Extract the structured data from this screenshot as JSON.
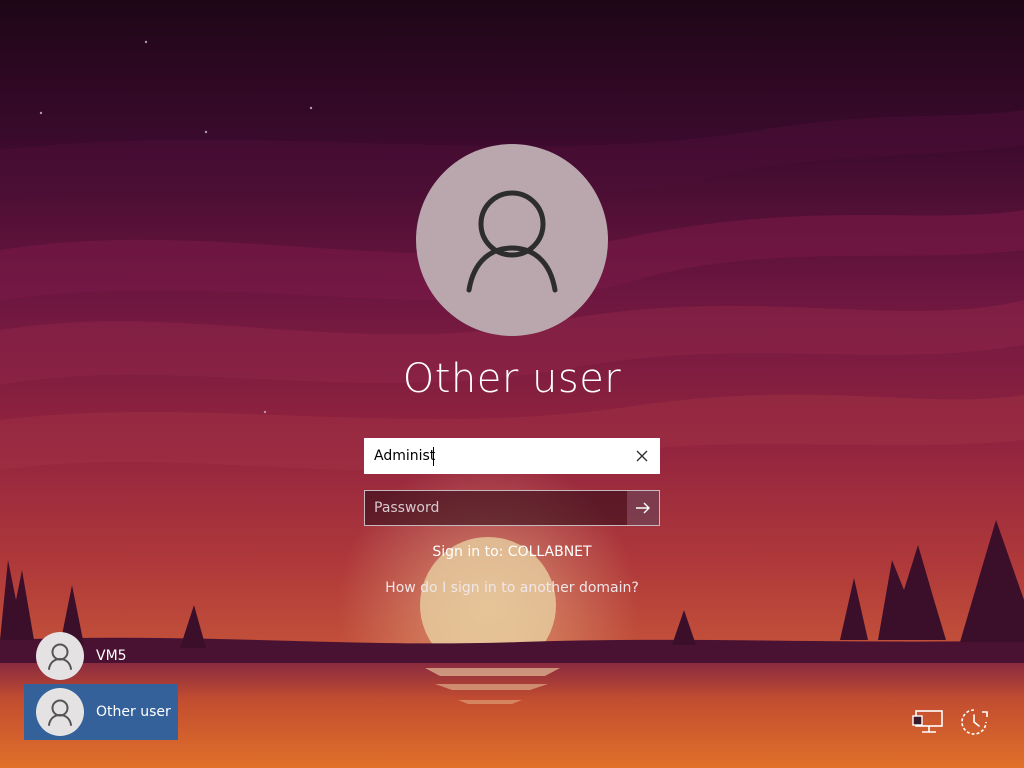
{
  "login": {
    "user_title": "Other user",
    "username_value": "Administ",
    "password_placeholder": "Password",
    "sign_in_to": "Sign in to: COLLABNET",
    "domain_help_link": "How do I sign in to another domain?"
  },
  "user_list": [
    {
      "label": "VM5",
      "selected": false
    },
    {
      "label": "Other user",
      "selected": true
    }
  ],
  "icons": {
    "clear": "close-icon",
    "submit": "arrow-right-icon",
    "network": "network-icon",
    "accessibility": "ease-of-access-icon",
    "avatar": "user-icon"
  },
  "colors": {
    "selected_tile": "#35619b",
    "avatar_bg": "#b9a7ad"
  }
}
